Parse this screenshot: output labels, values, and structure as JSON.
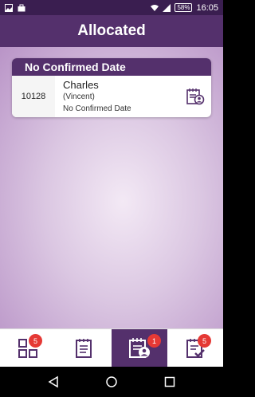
{
  "status_bar": {
    "battery": "58%",
    "time": "16:05"
  },
  "header": {
    "title": "Allocated"
  },
  "card": {
    "section_title": "No Confirmed Date",
    "id": "10128",
    "name": "Charles",
    "alias": "(Vincent)",
    "status": "No Confirmed Date"
  },
  "bottom_nav": {
    "items": [
      {
        "icon": "dashboard-grid-icon",
        "badge": "5",
        "active": false
      },
      {
        "icon": "notepad-icon",
        "badge": "",
        "active": false
      },
      {
        "icon": "allocated-notepad-user-icon",
        "badge": "1",
        "active": true
      },
      {
        "icon": "checklist-icon",
        "badge": "5",
        "active": false
      }
    ]
  },
  "colors": {
    "primary": "#54306c",
    "badge": "#e53935"
  }
}
